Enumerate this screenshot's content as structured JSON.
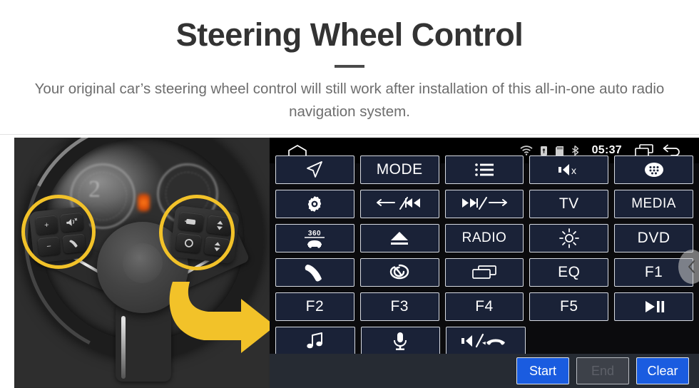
{
  "header": {
    "title": "Steering Wheel Control",
    "subtitle": "Your original car’s steering wheel control will still work after installation of this all-in-one auto radio navigation system."
  },
  "photo": {
    "alt_name": "steering-wheel-photo",
    "gauge_number": "2",
    "highlight_color": "#f2c229",
    "arrow_color": "#f2c229",
    "left_pod_keys": [
      "+",
      "−",
      "mute-icon",
      "phone-icon"
    ],
    "right_pod_keys": [
      "display-icon",
      "up-arrow-icon",
      "circle-icon",
      "down-arrow-icon"
    ]
  },
  "radio": {
    "statusbar": {
      "home_icon": "home-icon",
      "icons": [
        "wifi-icon",
        "usb-lock-icon",
        "sdcard-icon",
        "bluetooth-icon"
      ],
      "clock": "05:37",
      "recents_icon": "recents-icon",
      "back_icon": "back-icon"
    },
    "panel_bg": "#0b0b0d",
    "button_bg": "#1a2237",
    "button_border": "#d7dbe2",
    "rows": [
      [
        {
          "name": "navigation",
          "type": "icon",
          "icon": "navigation-arrow-icon",
          "label": ""
        },
        {
          "name": "mode",
          "type": "text",
          "icon": "",
          "label": "MODE"
        },
        {
          "name": "list",
          "type": "icon",
          "icon": "list-icon",
          "label": ""
        },
        {
          "name": "mute",
          "type": "icon",
          "icon": "mute-icon",
          "label": ""
        },
        {
          "name": "apps",
          "type": "icon",
          "icon": "apps-grid-icon",
          "label": ""
        }
      ],
      [
        {
          "name": "settings",
          "type": "icon",
          "icon": "gear-icon",
          "label": ""
        },
        {
          "name": "previous",
          "type": "icon",
          "icon": "prev-track-icon",
          "label": ""
        },
        {
          "name": "next",
          "type": "icon",
          "icon": "next-track-icon",
          "label": ""
        },
        {
          "name": "tv",
          "type": "text",
          "icon": "",
          "label": "TV"
        },
        {
          "name": "media",
          "type": "text",
          "icon": "",
          "label": "MEDIA"
        }
      ],
      [
        {
          "name": "camera-360",
          "type": "icon",
          "icon": "car-360-icon",
          "label": ""
        },
        {
          "name": "eject",
          "type": "icon",
          "icon": "eject-icon",
          "label": ""
        },
        {
          "name": "radio",
          "type": "text",
          "icon": "",
          "label": "RADIO"
        },
        {
          "name": "brightness",
          "type": "icon",
          "icon": "brightness-icon",
          "label": ""
        },
        {
          "name": "dvd",
          "type": "text",
          "icon": "",
          "label": "DVD"
        }
      ],
      [
        {
          "name": "phone",
          "type": "icon",
          "icon": "phone-icon",
          "label": ""
        },
        {
          "name": "voice-assistant",
          "type": "icon",
          "icon": "swirl-icon",
          "label": ""
        },
        {
          "name": "screen-off",
          "type": "icon",
          "icon": "window-icon",
          "label": ""
        },
        {
          "name": "eq",
          "type": "text",
          "icon": "",
          "label": "EQ"
        },
        {
          "name": "f1",
          "type": "text",
          "icon": "",
          "label": "F1"
        }
      ],
      [
        {
          "name": "f2",
          "type": "text",
          "icon": "",
          "label": "F2"
        },
        {
          "name": "f3",
          "type": "text",
          "icon": "",
          "label": "F3"
        },
        {
          "name": "f4",
          "type": "text",
          "icon": "",
          "label": "F4"
        },
        {
          "name": "f5",
          "type": "text",
          "icon": "",
          "label": "F5"
        },
        {
          "name": "play-pause",
          "type": "icon",
          "icon": "play-pause-icon",
          "label": ""
        }
      ],
      [
        {
          "name": "music",
          "type": "icon",
          "icon": "music-note-icon",
          "label": ""
        },
        {
          "name": "microphone",
          "type": "icon",
          "icon": "microphone-icon",
          "label": ""
        },
        {
          "name": "answer-hangup",
          "type": "icon",
          "icon": "speaker-hangup-icon",
          "label": ""
        }
      ]
    ],
    "actions": [
      {
        "name": "start",
        "label": "Start",
        "state": "enabled",
        "color": "#1a5ce0"
      },
      {
        "name": "end",
        "label": "End",
        "state": "disabled",
        "color": "#3d4149"
      },
      {
        "name": "clear",
        "label": "Clear",
        "state": "enabled",
        "color": "#1a5ce0"
      }
    ],
    "drawer_handle_icon": "chevron-left-icon"
  }
}
